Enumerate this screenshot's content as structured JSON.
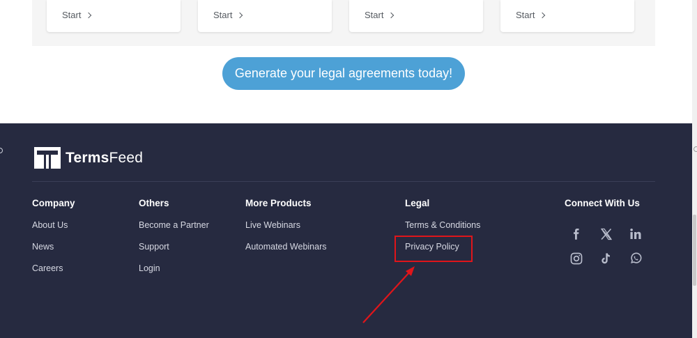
{
  "cards": [
    {
      "label": "Start"
    },
    {
      "label": "Start"
    },
    {
      "label": "Start"
    },
    {
      "label": "Start"
    }
  ],
  "cta_label": "Generate your legal agreements today!",
  "footer": {
    "brand": {
      "part1": "Terms",
      "part2": "Feed"
    },
    "columns": [
      {
        "heading": "Company",
        "links": [
          "About Us",
          "News",
          "Careers"
        ]
      },
      {
        "heading": "Others",
        "links": [
          "Become a Partner",
          "Support",
          "Login"
        ]
      },
      {
        "heading": "More Products",
        "links": [
          "Live Webinars",
          "Automated Webinars"
        ]
      },
      {
        "heading": "Legal",
        "links": [
          "Terms & Conditions",
          "Privacy Policy"
        ]
      }
    ],
    "connect_heading": "Connect With Us",
    "social_icons": [
      "facebook-icon",
      "x-icon",
      "linkedin-icon",
      "instagram-icon",
      "tiktok-icon",
      "whatsapp-icon"
    ]
  },
  "colors": {
    "footer_bg": "#262a40",
    "cta_bg": "#4da1d6",
    "highlight": "#e0151a"
  }
}
